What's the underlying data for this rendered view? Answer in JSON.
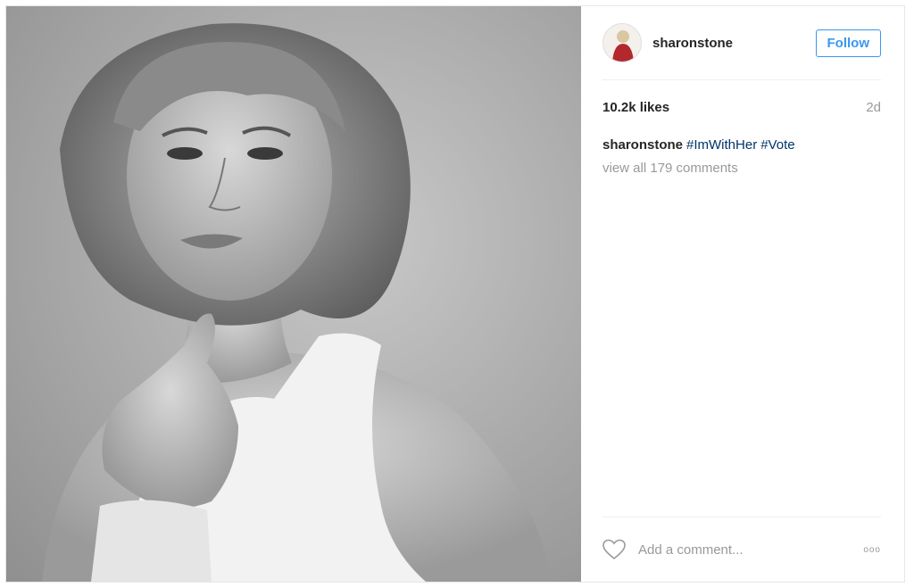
{
  "post": {
    "username": "sharonstone",
    "follow_label": "Follow",
    "likes": "10.2k likes",
    "time_ago": "2d",
    "caption": {
      "username": "sharonstone",
      "hashtags": [
        "#ImWithHer",
        "#Vote"
      ]
    },
    "view_comments": "view all 179 comments",
    "comment_placeholder": "Add a comment...",
    "more_label": "ooo"
  },
  "colors": {
    "accent": "#3897f0",
    "hashtag": "#003569",
    "muted": "#999999",
    "text": "#262626"
  },
  "icons": [
    "heart-icon",
    "more-options-icon"
  ]
}
